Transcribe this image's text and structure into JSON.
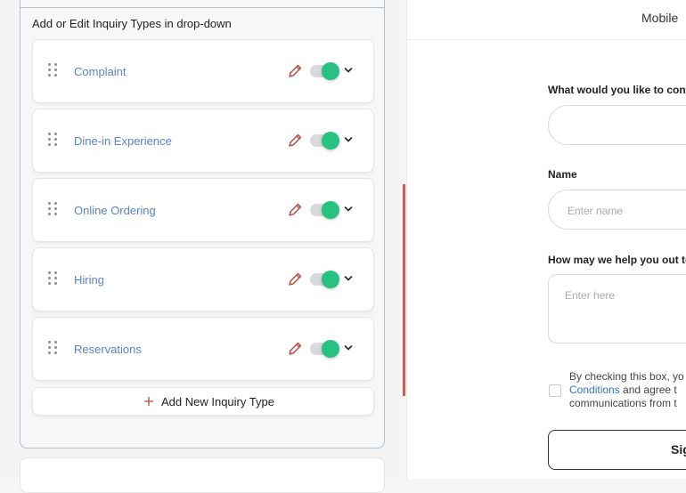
{
  "editor": {
    "section_title": "Add or Edit Inquiry Types in drop-down",
    "inquiry_types": [
      {
        "label": "Complaint",
        "enabled": true
      },
      {
        "label": "Dine-in Experience",
        "enabled": true
      },
      {
        "label": "Online Ordering",
        "enabled": true
      },
      {
        "label": "Hiring",
        "enabled": true
      },
      {
        "label": "Reservations",
        "enabled": true
      }
    ],
    "add_button_label": "Add New Inquiry Type",
    "icons": {
      "drag": "drag-handle-icon",
      "edit": "pencil-icon",
      "expand": "chevron-down-icon",
      "add": "plus-icon"
    }
  },
  "preview": {
    "view_tab": "Mobile",
    "contact_question_label": "What would you like to conta",
    "name_label": "Name",
    "name_placeholder": "Enter name",
    "help_label": "How may we help you out tod",
    "help_placeholder": "Enter here",
    "consent_line1": "By checking this box, yo",
    "consent_link": "Conditions",
    "consent_line2_rest": " and agree t",
    "consent_line3": "communications from t",
    "submit_label": "Sig"
  },
  "colors": {
    "accent_green": "#27c281",
    "link_blue": "#5b83c6",
    "edit_red": "#b4473e",
    "scroll_marker": "#cf5a52"
  }
}
